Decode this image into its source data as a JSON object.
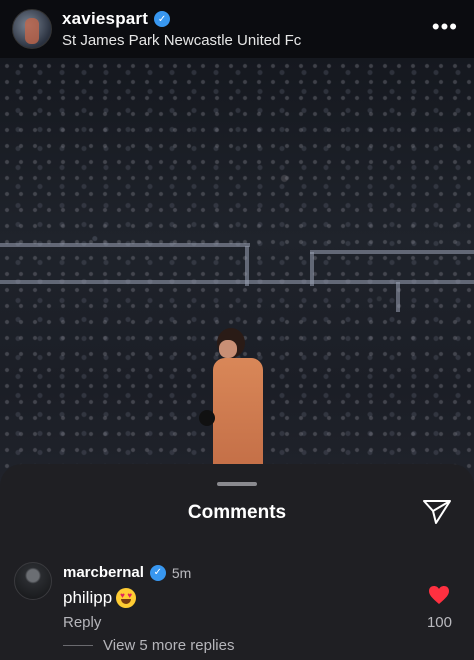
{
  "post_header": {
    "username": "xaviespart",
    "location": "St James Park Newcastle United Fc",
    "more_label": "•••"
  },
  "comments_sheet": {
    "title": "Comments",
    "comment": {
      "username": "marcbernal",
      "time": "5m",
      "text": "philipp",
      "reply_label": "Reply",
      "view_replies": "View 5 more replies",
      "like_count": "100"
    }
  },
  "colors": {
    "verified_blue": "#3897f0",
    "heart_red": "#ff3040",
    "sheet_bg": "#1f1f23"
  },
  "icons": [
    "verified-badge-icon",
    "more-options-icon",
    "share-icon",
    "heart-icon",
    "heart-eyes-emoji"
  ]
}
